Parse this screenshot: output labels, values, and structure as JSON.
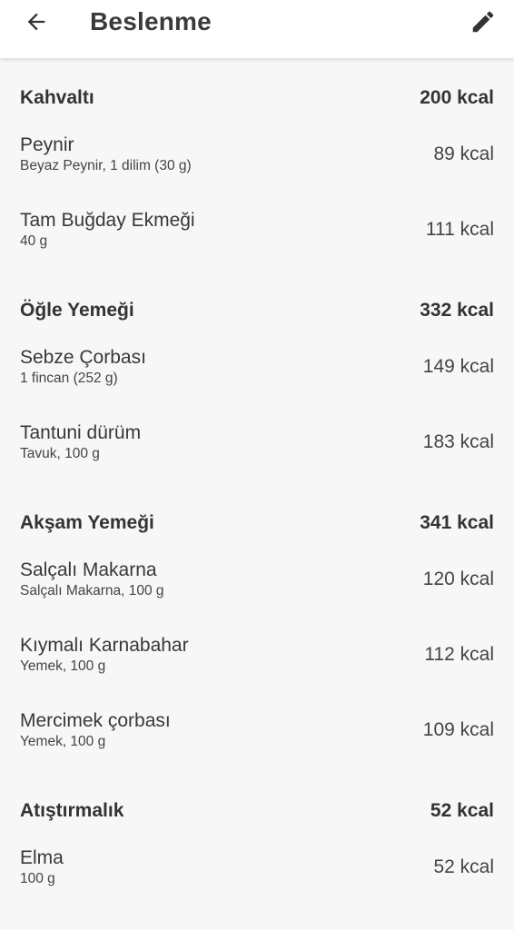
{
  "header": {
    "title": "Beslenme"
  },
  "sections": [
    {
      "name": "Kahvaltı",
      "kcal": "200 kcal",
      "items": [
        {
          "name": "Peynir",
          "desc": "Beyaz Peynir, 1 dilim (30 g)",
          "kcal": "89 kcal"
        },
        {
          "name": "Tam Buğday Ekmeği",
          "desc": "40 g",
          "kcal": "111 kcal"
        }
      ]
    },
    {
      "name": "Öğle Yemeği",
      "kcal": "332 kcal",
      "items": [
        {
          "name": "Sebze Çorbası",
          "desc": "1 fincan (252 g)",
          "kcal": "149 kcal"
        },
        {
          "name": "Tantuni dürüm",
          "desc": "Tavuk, 100 g",
          "kcal": "183 kcal"
        }
      ]
    },
    {
      "name": "Akşam Yemeği",
      "kcal": "341 kcal",
      "items": [
        {
          "name": "Salçalı Makarna",
          "desc": "Salçalı Makarna, 100 g",
          "kcal": "120 kcal"
        },
        {
          "name": "Kıymalı Karnabahar",
          "desc": "Yemek, 100 g",
          "kcal": "112 kcal"
        },
        {
          "name": "Mercimek çorbası",
          "desc": "Yemek, 100 g",
          "kcal": "109 kcal"
        }
      ]
    },
    {
      "name": "Atıştırmalık",
      "kcal": "52 kcal",
      "items": [
        {
          "name": "Elma",
          "desc": "100 g",
          "kcal": "52 kcal"
        }
      ]
    }
  ]
}
